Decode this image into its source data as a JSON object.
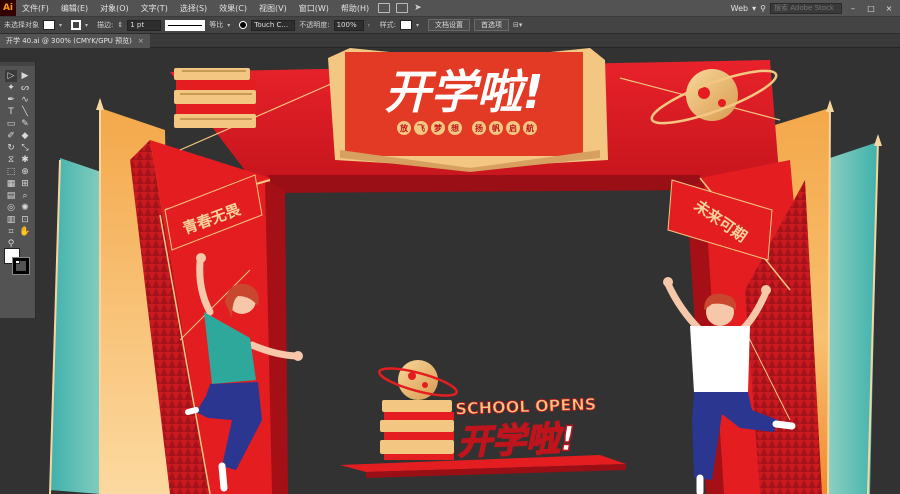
{
  "app": {
    "logo": "Ai"
  },
  "menu": {
    "items": [
      "文件(F)",
      "编辑(E)",
      "对象(O)",
      "文字(T)",
      "选择(S)",
      "效果(C)",
      "视图(V)",
      "窗口(W)",
      "帮助(H)"
    ],
    "workspace": "Web",
    "search_placeholder": "搜索 Adobe Stock",
    "window_buttons": [
      "–",
      "□",
      "×"
    ]
  },
  "control": {
    "selection_label": "未选择对象",
    "stroke_label": "描边:",
    "stroke_weight": "1 pt",
    "stroke_profile": "等比",
    "brush": "Touch C...",
    "opacity_label": "不透明度:",
    "opacity_value": "100%",
    "style_label": "样式:",
    "doc_setup_button": "文档设置",
    "preferences_button": "首选项"
  },
  "document": {
    "tab_title": "开学 40.ai @ 300% (CMYK/GPU 预览)",
    "close": "×"
  },
  "tools": [
    {
      "name": "selection-tool",
      "glyph": "▷"
    },
    {
      "name": "direct-selection-tool",
      "glyph": "▶"
    },
    {
      "name": "magic-wand-tool",
      "glyph": "✦"
    },
    {
      "name": "lasso-tool",
      "glyph": "ᔕ"
    },
    {
      "name": "pen-tool",
      "glyph": "✒"
    },
    {
      "name": "curvature-tool",
      "glyph": "∿"
    },
    {
      "name": "type-tool",
      "glyph": "T"
    },
    {
      "name": "line-tool",
      "glyph": "╲"
    },
    {
      "name": "rectangle-tool",
      "glyph": "▭"
    },
    {
      "name": "paintbrush-tool",
      "glyph": "✎"
    },
    {
      "name": "shaper-tool",
      "glyph": "✐"
    },
    {
      "name": "eraser-tool",
      "glyph": "◆"
    },
    {
      "name": "rotate-tool",
      "glyph": "↻"
    },
    {
      "name": "scale-tool",
      "glyph": "⤡"
    },
    {
      "name": "width-tool",
      "glyph": "⧖"
    },
    {
      "name": "puppet-warp-tool",
      "glyph": "✱"
    },
    {
      "name": "free-transform-tool",
      "glyph": "⬚"
    },
    {
      "name": "shape-builder-tool",
      "glyph": "⊕"
    },
    {
      "name": "perspective-grid-tool",
      "glyph": "▦"
    },
    {
      "name": "mesh-tool",
      "glyph": "⊞"
    },
    {
      "name": "gradient-tool",
      "glyph": "▤"
    },
    {
      "name": "eyedropper-tool",
      "glyph": "⌕"
    },
    {
      "name": "blend-tool",
      "glyph": "◎"
    },
    {
      "name": "symbol-sprayer-tool",
      "glyph": "✺"
    },
    {
      "name": "column-graph-tool",
      "glyph": "▥"
    },
    {
      "name": "artboard-tool",
      "glyph": "⊡"
    },
    {
      "name": "slice-tool",
      "glyph": "⌗"
    },
    {
      "name": "hand-tool",
      "glyph": "✋"
    },
    {
      "name": "zoom-tool",
      "glyph": "⚲"
    }
  ],
  "artwork": {
    "headline": "开学啦!",
    "subtitle_chars": [
      "放",
      "飞",
      "梦",
      "想",
      "扬",
      "帆",
      "启",
      "航"
    ],
    "left_banner": "青春无畏",
    "right_banner": "未来可期",
    "school_opens": "SCHOOL OPENS",
    "bottom_headline": "开学啦!",
    "colors": {
      "arch_red": "#e41e20",
      "dark_red": "#a50f16",
      "gold": "#f3c782",
      "orange": "#f29a3a",
      "teal": "#49b7b0",
      "canvas": "#323232"
    }
  }
}
